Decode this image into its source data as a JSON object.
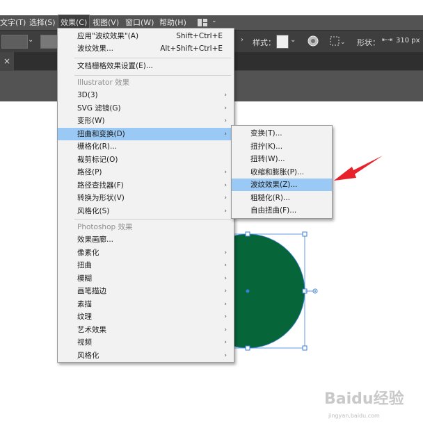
{
  "menubar": {
    "items": [
      {
        "label": "文字(T)"
      },
      {
        "label": "选择(S)"
      },
      {
        "label": "效果(C)"
      },
      {
        "label": "视图(V)"
      },
      {
        "label": "窗口(W)"
      },
      {
        "label": "帮助(H)"
      }
    ]
  },
  "controlbar": {
    "style_label": "样式：",
    "shape_label": "形状：",
    "width_value": "310 px"
  },
  "doc_tab": {
    "close": "×"
  },
  "effect_menu": {
    "apply_last": {
      "label": "应用\"波纹效果\"(A)",
      "shortcut": "Shift+Ctrl+E"
    },
    "last_effect": {
      "label": "波纹效果...",
      "shortcut": "Alt+Shift+Ctrl+E"
    },
    "document_raster": {
      "label": "文档栅格效果设置(E)..."
    },
    "illustrator_header": "Illustrator 效果",
    "illustrator_items": [
      {
        "label": "3D(3)"
      },
      {
        "label": "SVG 滤镜(G)"
      },
      {
        "label": "变形(W)"
      },
      {
        "label": "扭曲和变换(D)"
      },
      {
        "label": "栅格化(R)..."
      },
      {
        "label": "裁剪标记(O)"
      },
      {
        "label": "路径(P)"
      },
      {
        "label": "路径查找器(F)"
      },
      {
        "label": "转换为形状(V)"
      },
      {
        "label": "风格化(S)"
      }
    ],
    "photoshop_header": "Photoshop 效果",
    "photoshop_items": [
      {
        "label": "效果画廊..."
      },
      {
        "label": "像素化"
      },
      {
        "label": "扭曲"
      },
      {
        "label": "模糊"
      },
      {
        "label": "画笔描边"
      },
      {
        "label": "素描"
      },
      {
        "label": "纹理"
      },
      {
        "label": "艺术效果"
      },
      {
        "label": "视频"
      },
      {
        "label": "风格化"
      }
    ]
  },
  "distort_submenu": {
    "items": [
      {
        "label": "变换(T)..."
      },
      {
        "label": "扭拧(K)..."
      },
      {
        "label": "扭转(W)..."
      },
      {
        "label": "收缩和膨胀(P)..."
      },
      {
        "label": "波纹效果(Z)..."
      },
      {
        "label": "粗糙化(R)..."
      },
      {
        "label": "自由扭曲(F)..."
      }
    ]
  },
  "canvas": {
    "circle_fill": "#06663a",
    "selection_color": "#3b7fd9",
    "arrow_color": "#e8222a"
  },
  "watermark": {
    "text": "Baidu经验",
    "sub": "jingyan.baidu.com"
  },
  "colors": {
    "menu_highlight": "#99c9f4",
    "menubar_bg": "#535353",
    "menu_bg": "#f2f2f2"
  }
}
